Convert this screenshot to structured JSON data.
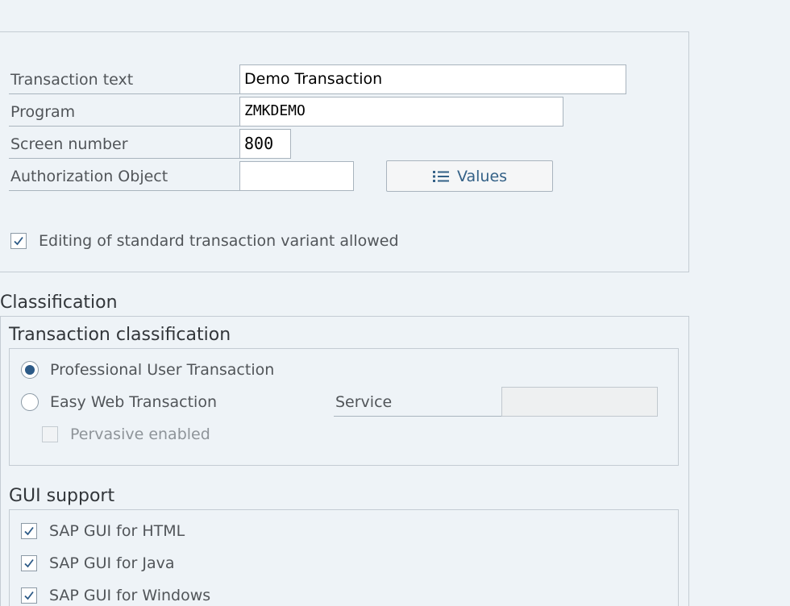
{
  "header": {
    "transaction_text_label": "Transaction text",
    "transaction_text_value": "Demo Transaction",
    "program_label": "Program",
    "program_value": "ZMKDEMO",
    "screen_number_label": "Screen number",
    "screen_number_value": "800",
    "auth_object_label": "Authorization Object",
    "auth_object_value": "",
    "values_button_label": "Values",
    "values_button_icon": "list-icon",
    "editing_variant_label": "Editing of standard transaction variant allowed",
    "editing_variant_checked": true
  },
  "classification": {
    "title": "Classification",
    "transaction_classification": {
      "title": "Transaction classification",
      "professional_label": "Professional User Transaction",
      "easy_web_label": "Easy Web Transaction",
      "selected": "professional",
      "pervasive_label": "Pervasive enabled",
      "service_label": "Service",
      "service_value": ""
    },
    "gui_support": {
      "title": "GUI support",
      "html_label": "SAP GUI for HTML",
      "java_label": "SAP GUI for Java",
      "windows_label": "SAP GUI for Windows"
    }
  },
  "colors": {
    "background": "#eef3f7",
    "accent": "#2c5a87",
    "button_text": "#346187"
  }
}
